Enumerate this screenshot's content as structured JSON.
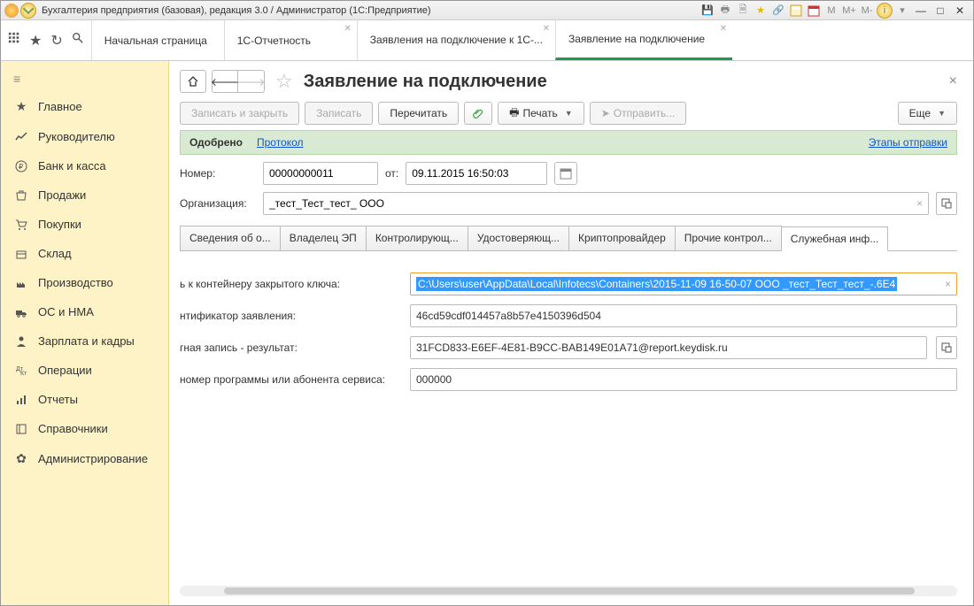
{
  "titlebar": {
    "title": "Бухгалтерия предприятия (базовая), редакция 3.0 / Администратор  (1С:Предприятие)",
    "calc_labels": [
      "M",
      "M+",
      "M-"
    ]
  },
  "tabs": [
    {
      "label": "Начальная страница",
      "closable": false
    },
    {
      "label": "1С-Отчетность",
      "closable": true
    },
    {
      "label": "Заявления на подключение к 1С-...",
      "closable": true
    },
    {
      "label": "Заявление на подключение",
      "closable": true,
      "active": true
    }
  ],
  "sidebar": {
    "items": [
      {
        "icon": "≡",
        "label": "Главное"
      },
      {
        "icon": "chart",
        "label": "Руководителю"
      },
      {
        "icon": "ruble",
        "label": "Банк и касса"
      },
      {
        "icon": "bag",
        "label": "Продажи"
      },
      {
        "icon": "cart",
        "label": "Покупки"
      },
      {
        "icon": "box",
        "label": "Склад"
      },
      {
        "icon": "factory",
        "label": "Производство"
      },
      {
        "icon": "truck",
        "label": "ОС и НМА"
      },
      {
        "icon": "person",
        "label": "Зарплата и кадры"
      },
      {
        "icon": "ops",
        "label": "Операции"
      },
      {
        "icon": "report",
        "label": "Отчеты"
      },
      {
        "icon": "book",
        "label": "Справочники"
      },
      {
        "icon": "gear",
        "label": "Администрирование"
      }
    ]
  },
  "page": {
    "title": "Заявление на подключение",
    "toolbar": {
      "save_close": "Записать и закрыть",
      "save": "Записать",
      "reread": "Перечитать",
      "print": "Печать",
      "send": "Отправить...",
      "more": "Еще"
    },
    "status": {
      "label": "Одобрено",
      "protocol": "Протокол",
      "stages": "Этапы отправки"
    },
    "form": {
      "number_label": "Номер:",
      "number_value": "00000000011",
      "from_label": "от:",
      "date_value": "09.11.2015 16:50:03",
      "org_label": "Организация:",
      "org_value": "_тест_Тест_тест_ ООО"
    },
    "inner_tabs": [
      "Сведения об о...",
      "Владелец ЭП",
      "Контролирующ...",
      "Удостоверяющ...",
      "Криптопровайдер",
      "Прочие контрол...",
      "Служебная инф..."
    ],
    "fields": {
      "container_label": "ь к контейнеру закрытого ключа:",
      "container_value": "C:\\Users\\user\\AppData\\Local\\Infotecs\\Containers\\2015-11-09 16-50-07 ООО _тест_Тест_тест_-.6E4",
      "ident_label": "нтификатор заявления:",
      "ident_value": "46cd59cdf014457a8b57e4150396d504",
      "account_label": "гная запись - результат:",
      "account_value": "31FCD833-E6EF-4E81-B9CC-BAB149E01A71@report.keydisk.ru",
      "prognum_label": "номер программы или абонента сервиса:",
      "prognum_value": "000000"
    }
  }
}
